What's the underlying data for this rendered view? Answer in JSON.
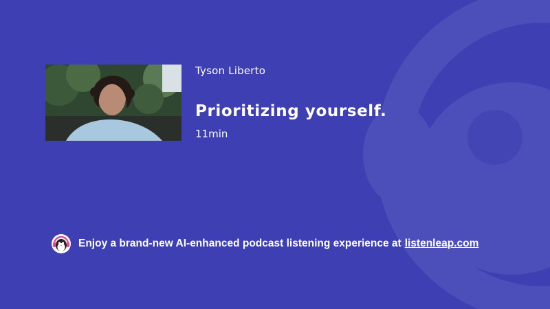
{
  "episode": {
    "author": "Tyson Liberto",
    "title": "Prioritizing yourself.",
    "duration": "11min"
  },
  "promo": {
    "text": "Enjoy a brand-new AI-enhanced podcast listening experience at",
    "link_label": "listenleap.com"
  },
  "colors": {
    "background": "#3d3fb3",
    "text": "#ffffff"
  },
  "icons": {
    "background": "penguin-headphones-watermark-icon",
    "promo": "penguin-logo-icon"
  }
}
